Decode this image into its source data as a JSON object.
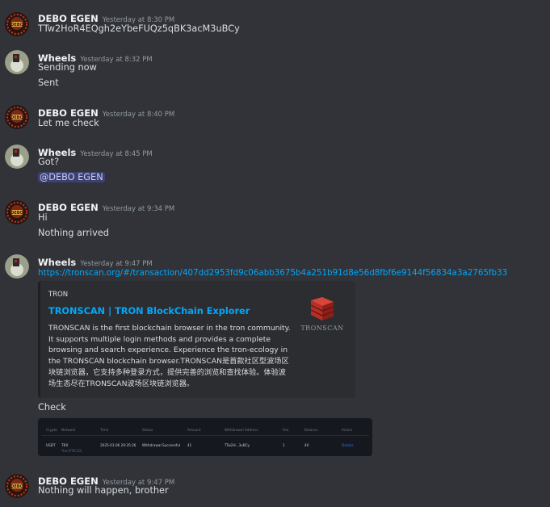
{
  "messages": [
    {
      "author": "DEBO EGEN",
      "avatar": "debo",
      "timestamp": "Yesterday at 8:30 PM",
      "lines": [
        "TTw2HoR4EQgh2eYbeFUQz5qBK3acM3uBCy"
      ]
    },
    {
      "author": "Wheels",
      "avatar": "wheels",
      "timestamp": "Yesterday at 8:32 PM",
      "lines": [
        "Sending now",
        "Sent"
      ]
    },
    {
      "author": "DEBO EGEN",
      "avatar": "debo",
      "timestamp": "Yesterday at 8:40 PM",
      "lines": [
        "Let me check"
      ]
    },
    {
      "author": "Wheels",
      "avatar": "wheels",
      "timestamp": "Yesterday at 8:45 PM",
      "lines": [
        "Got?"
      ],
      "mention": "@DEBO EGEN"
    },
    {
      "author": "DEBO EGEN",
      "avatar": "debo",
      "timestamp": "Yesterday at 9:34 PM",
      "lines": [
        "Hi",
        "Nothing arrived"
      ]
    },
    {
      "author": "Wheels",
      "avatar": "wheels",
      "timestamp": "Yesterday at 9:47 PM",
      "link": "https://tronscan.org/#/transaction/407dd2953fd9c06abb3675b4a251b91d8e56d8fbf6e9144f56834a3a2765fb33",
      "after_attachment_text": "Check"
    },
    {
      "author": "DEBO EGEN",
      "avatar": "debo",
      "timestamp": "Yesterday at 9:47 PM",
      "lines": [
        "Nothing will happen, brother"
      ]
    }
  ],
  "embed": {
    "provider": "TRON",
    "title": "TRONSCAN | TRON BlockChain Explorer",
    "description": "TRONSCAN is the first blockchain browser in the tron community. It supports multiple login methods and provides a complete browsing and search experience. Experience the tron-ecology in the TRONSCAN blockchain browser.TRONSCAN是首款社区型波场区块链浏览器，它支持多种登录方式，提供完善的浏览和查找体验。体验波场生态尽在TRONSCAN波场区块链浏览器。",
    "thumbnail_text": "TRONSCAN",
    "thumbnail_icon": "tronscan-cube-logo"
  },
  "attachment": {
    "headers": [
      "Crypto",
      "Network",
      "Time",
      "Status",
      "Amount",
      "Withdrawal Address",
      "Fee",
      "Balance",
      "Action"
    ],
    "row": [
      "USDT",
      "TRX",
      "2025-01-06 20:35:26",
      "Withdrawal Successful",
      "41",
      "TTw2H...3uBCy",
      "1",
      "40",
      "Details"
    ],
    "network_sub": "Tron(TRC20)"
  },
  "colors": {
    "background": "#313338",
    "link": "#00a8fc",
    "mention_bg": "#5865f2",
    "embed_bg": "#2b2d31"
  }
}
